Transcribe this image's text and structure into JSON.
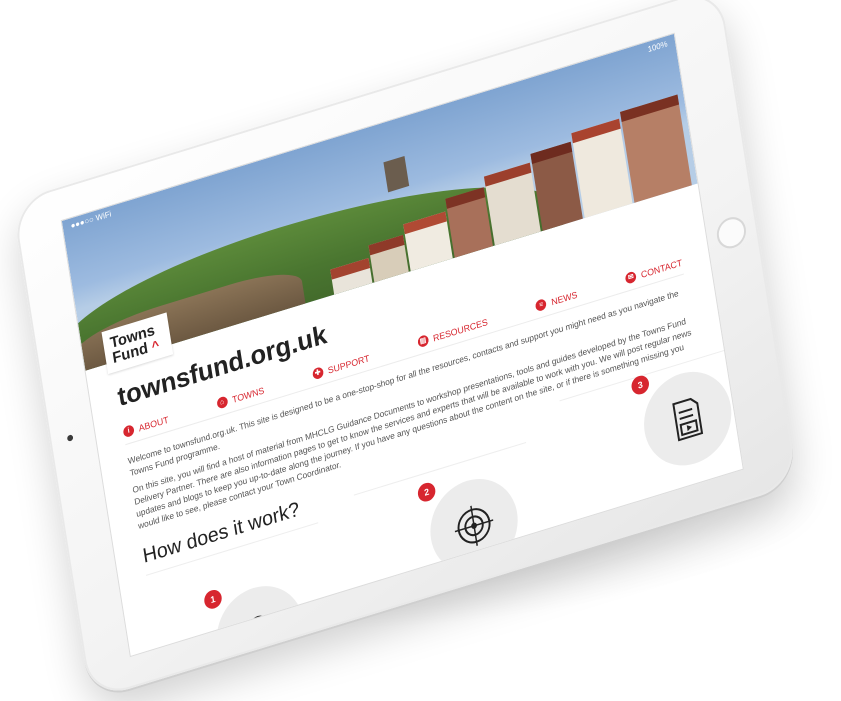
{
  "status": {
    "left": "●●●○○ WiFi",
    "right": "100%"
  },
  "logo": {
    "line1": "Towns",
    "line2": "Fund"
  },
  "site": {
    "title": "townsfund.org.uk"
  },
  "nav": {
    "items": [
      {
        "label": "ABOUT",
        "icon": "info-icon",
        "glyph": "i"
      },
      {
        "label": "TOWNS",
        "icon": "home-icon",
        "glyph": "⌂"
      },
      {
        "label": "SUPPORT",
        "icon": "support-icon",
        "glyph": "✚"
      },
      {
        "label": "RESOURCES",
        "icon": "resources-icon",
        "glyph": "▤"
      },
      {
        "label": "NEWS",
        "icon": "news-icon",
        "glyph": "≡"
      },
      {
        "label": "CONTACT",
        "icon": "contact-icon",
        "glyph": "✉"
      }
    ]
  },
  "intro": {
    "p1": "Welcome to townsfund.org.uk. This site is designed to be a one-stop-shop for all the resources, contacts and support you might need as you navigate the Towns Fund programme.",
    "p2": "On this site, you will find a host of material from MHCLG Guidance Documents to workshop presentations, tools and guides developed by the Towns Fund Delivery Partner. There are also information pages to get to know the services and experts that will be available to work with you. We will post regular news updates and blogs to keep you up-to-date along the journey. If you have any questions about the content on the site, or if there is something missing you would like to see, please contact your Town Coordinator."
  },
  "how": {
    "heading": "How does it work?",
    "steps": [
      {
        "num": "1",
        "icon": "lightbulb-box-icon"
      },
      {
        "num": "2",
        "icon": "target-icon"
      },
      {
        "num": "3",
        "icon": "document-media-icon"
      }
    ]
  },
  "colors": {
    "accent": "#d7262f",
    "text": "#222222",
    "muted": "#555555"
  }
}
